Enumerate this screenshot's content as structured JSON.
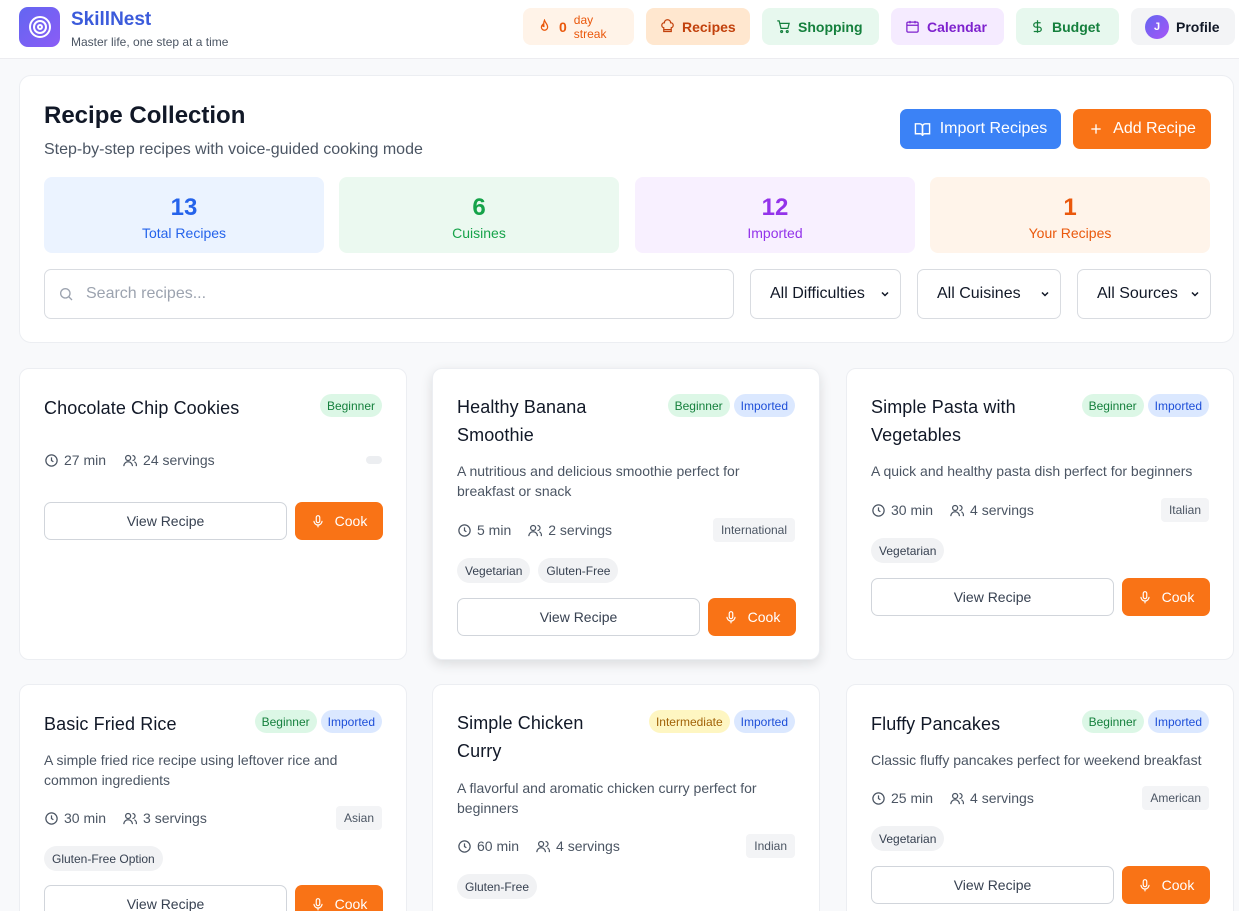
{
  "app": {
    "name": "SkillNest",
    "tagline": "Master life, one step at a time"
  },
  "nav": {
    "streak_count": "0",
    "streak_label": "day streak",
    "recipes": "Recipes",
    "shopping": "Shopping",
    "calendar": "Calendar",
    "budget": "Budget",
    "profile_initial": "J",
    "profile": "Profile"
  },
  "header": {
    "title": "Recipe Collection",
    "subtitle": "Step-by-step recipes with voice-guided cooking mode",
    "import_label": "Import Recipes",
    "add_label": "Add Recipe"
  },
  "stats": [
    {
      "value": "13",
      "label": "Total Recipes"
    },
    {
      "value": "6",
      "label": "Cuisines"
    },
    {
      "value": "12",
      "label": "Imported"
    },
    {
      "value": "1",
      "label": "Your Recipes"
    }
  ],
  "filters": {
    "search_placeholder": "Search recipes...",
    "difficulty": "All Difficulties",
    "cuisine": "All Cuisines",
    "source": "All Sources"
  },
  "buttons": {
    "view": "View Recipe",
    "cook": "Cook"
  },
  "recipes": [
    {
      "title": "Chocolate Chip Cookies",
      "difficulty": "Beginner",
      "time": "27 min",
      "servings": "24 servings"
    },
    {
      "title": "Healthy Banana Smoothie",
      "difficulty": "Beginner",
      "source": "Imported",
      "description": "A nutritious and delicious smoothie perfect for breakfast or snack",
      "time": "5 min",
      "servings": "2 servings",
      "cuisine": "International",
      "tags": [
        "Vegetarian",
        "Gluten-Free"
      ]
    },
    {
      "title": "Simple Pasta with Vegetables",
      "difficulty": "Beginner",
      "source": "Imported",
      "description": "A quick and healthy pasta dish perfect for beginners",
      "time": "30 min",
      "servings": "4 servings",
      "cuisine": "Italian",
      "tags": [
        "Vegetarian"
      ]
    },
    {
      "title": "Basic Fried Rice",
      "difficulty": "Beginner",
      "source": "Imported",
      "description": "A simple fried rice recipe using leftover rice and common ingredients",
      "time": "30 min",
      "servings": "3 servings",
      "cuisine": "Asian",
      "tags": [
        "Gluten-Free Option"
      ]
    },
    {
      "title": "Simple Chicken Curry",
      "difficulty": "Intermediate",
      "source": "Imported",
      "description": "A flavorful and aromatic chicken curry perfect for beginners",
      "time": "60 min",
      "servings": "4 servings",
      "cuisine": "Indian",
      "tags": [
        "Gluten-Free"
      ]
    },
    {
      "title": "Fluffy Pancakes",
      "difficulty": "Beginner",
      "source": "Imported",
      "description": "Classic fluffy pancakes perfect for weekend breakfast",
      "time": "25 min",
      "servings": "4 servings",
      "cuisine": "American",
      "tags": [
        "Vegetarian"
      ]
    }
  ],
  "colors": {
    "accent_orange": "#f97316",
    "accent_blue": "#3b82f6",
    "brand": "#3b5bdb"
  }
}
